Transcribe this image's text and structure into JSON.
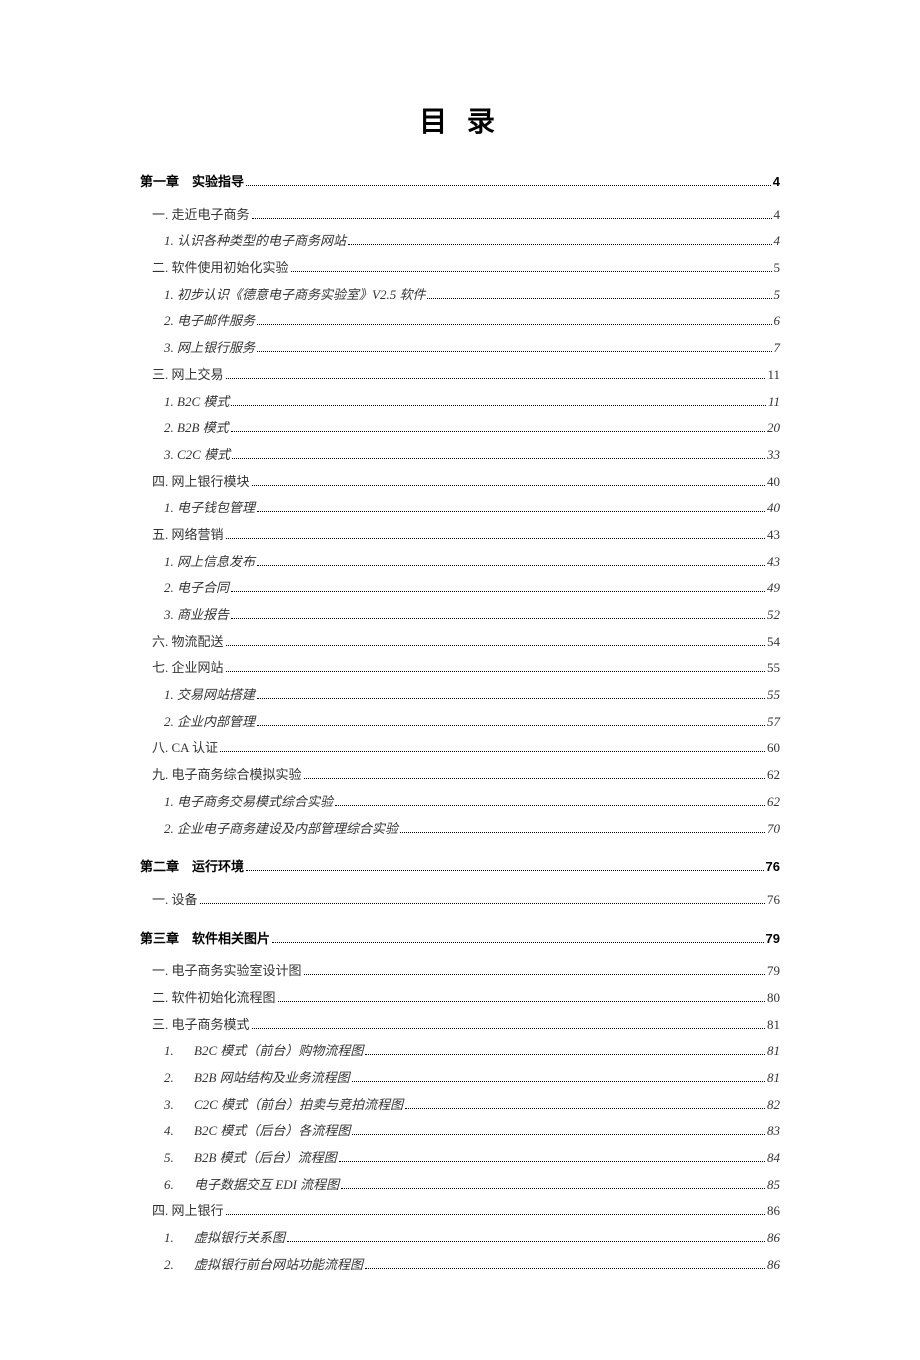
{
  "title": "目 录",
  "entries": [
    {
      "level": "chapter",
      "num": "第一章",
      "label": "实验指导",
      "page": "4"
    },
    {
      "level": "section",
      "label": "一. 走近电子商务",
      "page": "4"
    },
    {
      "level": "sub",
      "label": "1. 认识各种类型的电子商务网站",
      "page": "4"
    },
    {
      "level": "section",
      "label": "二. 软件使用初始化实验",
      "page": "5"
    },
    {
      "level": "sub",
      "label": "1. 初步认识《德意电子商务实验室》V2.5 软件",
      "page": "5"
    },
    {
      "level": "sub",
      "label": "2. 电子邮件服务",
      "page": "6"
    },
    {
      "level": "sub",
      "label": "3. 网上银行服务",
      "page": "7"
    },
    {
      "level": "section",
      "label": "三. 网上交易",
      "page": "11"
    },
    {
      "level": "sub",
      "label": "1. B2C 模式",
      "page": "11"
    },
    {
      "level": "sub",
      "label": "2. B2B 模式",
      "page": "20"
    },
    {
      "level": "sub",
      "label": "3. C2C 模式",
      "page": "33"
    },
    {
      "level": "section",
      "label": "四. 网上银行模块",
      "page": "40"
    },
    {
      "level": "sub",
      "label": "1. 电子钱包管理",
      "page": "40"
    },
    {
      "level": "section",
      "label": "五. 网络营销",
      "page": "43"
    },
    {
      "level": "sub",
      "label": "1. 网上信息发布",
      "page": "43"
    },
    {
      "level": "sub",
      "label": "2. 电子合同",
      "page": "49"
    },
    {
      "level": "sub",
      "label": "3. 商业报告",
      "page": "52"
    },
    {
      "level": "section",
      "label": "六. 物流配送",
      "page": "54"
    },
    {
      "level": "section",
      "label": "七. 企业网站",
      "page": "55"
    },
    {
      "level": "sub",
      "label": "1. 交易网站搭建",
      "page": "55"
    },
    {
      "level": "sub",
      "label": "2. 企业内部管理",
      "page": "57"
    },
    {
      "level": "section",
      "label": "八. CA 认证",
      "page": "60"
    },
    {
      "level": "section",
      "label": "九. 电子商务综合模拟实验",
      "page": "62"
    },
    {
      "level": "sub",
      "label": "1. 电子商务交易模式综合实验",
      "page": "62"
    },
    {
      "level": "sub",
      "label": "2. 企业电子商务建设及内部管理综合实验",
      "page": "70"
    },
    {
      "level": "chapter",
      "num": "第二章",
      "label": "运行环境",
      "page": "76"
    },
    {
      "level": "section",
      "label": "一. 设备",
      "page": "76"
    },
    {
      "level": "chapter",
      "num": "第三章",
      "label": "软件相关图片",
      "page": "79"
    },
    {
      "level": "section",
      "label": "一. 电子商务实验室设计图",
      "page": "79"
    },
    {
      "level": "section",
      "label": "二. 软件初始化流程图",
      "page": "80"
    },
    {
      "level": "section",
      "label": "三. 电子商务模式",
      "page": "81"
    },
    {
      "level": "sub2",
      "num": "1.",
      "label": "B2C 模式（前台）购物流程图",
      "page": "81"
    },
    {
      "level": "sub2",
      "num": "2.",
      "label": "B2B 网站结构及业务流程图",
      "page": "81"
    },
    {
      "level": "sub2",
      "num": "3.",
      "label": "C2C 模式（前台）拍卖与竞拍流程图",
      "page": "82"
    },
    {
      "level": "sub2",
      "num": "4.",
      "label": "B2C 模式（后台）各流程图",
      "page": "83"
    },
    {
      "level": "sub2",
      "num": "5.",
      "label": "B2B 模式（后台）流程图",
      "page": "84"
    },
    {
      "level": "sub2",
      "num": "6.",
      "label": "电子数据交互 EDI 流程图",
      "page": "85"
    },
    {
      "level": "section",
      "label": "四. 网上银行",
      "page": "86"
    },
    {
      "level": "sub2",
      "num": "1.",
      "label": "虚拟银行关系图",
      "page": "86"
    },
    {
      "level": "sub2",
      "num": "2.",
      "label": "虚拟银行前台网站功能流程图",
      "page": "86"
    }
  ]
}
